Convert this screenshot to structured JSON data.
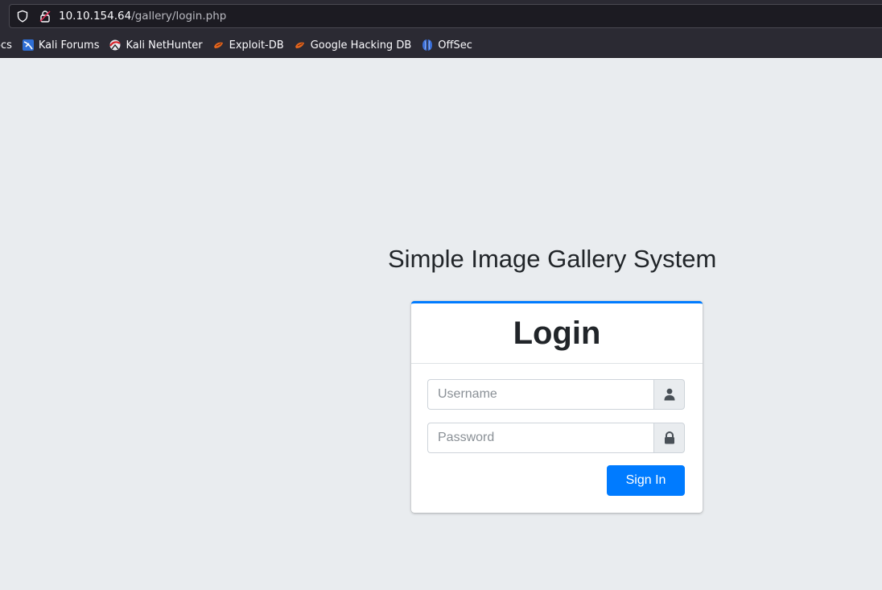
{
  "browser": {
    "url_host": "10.10.154.64",
    "url_path": "/gallery/login.php",
    "bookmarks": [
      {
        "label": "ocs",
        "icon": "kali-docs-icon"
      },
      {
        "label": "Kali Forums",
        "icon": "kali-forums-icon"
      },
      {
        "label": "Kali NetHunter",
        "icon": "kali-nethunter-icon"
      },
      {
        "label": "Exploit-DB",
        "icon": "exploit-db-icon"
      },
      {
        "label": "Google Hacking DB",
        "icon": "google-hacking-db-icon"
      },
      {
        "label": "OffSec",
        "icon": "offsec-icon"
      }
    ]
  },
  "page": {
    "site_title": "Simple Image Gallery System",
    "card_title": "Login",
    "username_placeholder": "Username",
    "password_placeholder": "Password",
    "sign_in_label": "Sign In"
  },
  "colors": {
    "accent": "#007bff",
    "page_background": "#e9ecef",
    "browser_chrome": "#2b2a33"
  }
}
